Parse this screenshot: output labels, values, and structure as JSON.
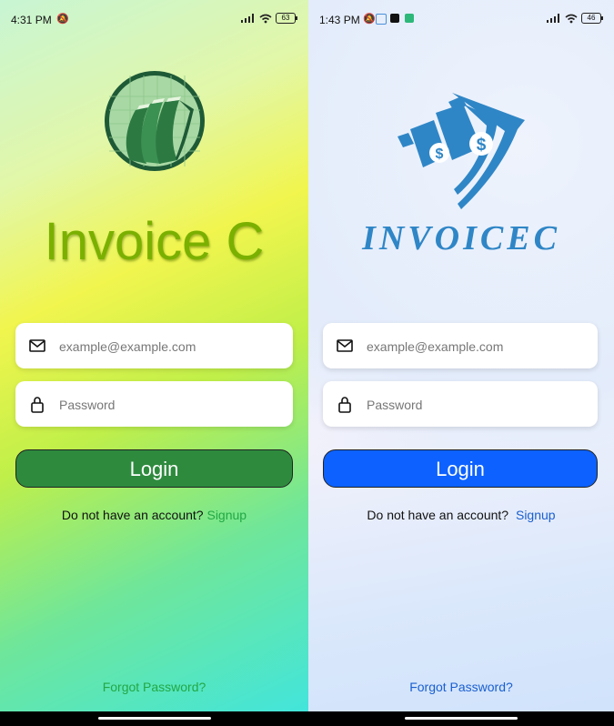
{
  "left": {
    "status": {
      "time": "4:31 PM",
      "battery": "63"
    },
    "title": "Invoice C",
    "email_placeholder": "example@example.com",
    "password_placeholder": "Password",
    "login_label": "Login",
    "signup_prompt": "Do not have an account?",
    "signup_link": "Signup",
    "forgot_link": "Forgot Password?",
    "colors": {
      "button": "#2e8b3e",
      "link": "#22a845",
      "title": "#7ab000"
    }
  },
  "right": {
    "status": {
      "time": "1:43 PM",
      "battery": "46"
    },
    "title": "INVOICEC",
    "email_placeholder": "example@example.com",
    "password_placeholder": "Password",
    "login_label": "Login",
    "signup_prompt": "Do not have an account?",
    "signup_link": "Signup",
    "forgot_link": "Forgot Password?",
    "colors": {
      "button": "#0d62ff",
      "link": "#1a5fd0",
      "title": "#2f86c6"
    }
  }
}
